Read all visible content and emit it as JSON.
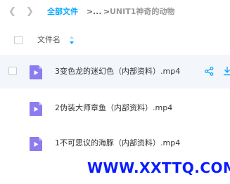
{
  "nav": {
    "back_icon": "chevron-left-icon",
    "forward_icon": "chevron-right-icon",
    "breadcrumb": {
      "root": "全部文件",
      "separator": ">",
      "ellipsis": "...",
      "current": "UNIT1神奇的动物"
    }
  },
  "list_header": {
    "name_label": "文件名",
    "sort_icon": "sort-icon"
  },
  "files": [
    {
      "name": "3变色龙的迷幻色（内部资料）.mp4",
      "icon": "video-file-icon"
    },
    {
      "name": "2伪装大师章鱼（内部资料）.mp4",
      "icon": "video-file-icon"
    },
    {
      "name": "1不可思议的海豚（内部资料）.mp4",
      "icon": "video-file-icon"
    }
  ],
  "row_actions": {
    "share_icon": "share-icon",
    "download_icon": "download-icon"
  },
  "watermark": "WWW.XXTTQ.COM",
  "colors": {
    "accent": "#06a7ff",
    "file_icon": "#8c7cf0",
    "hover_row": "#f3f6fb",
    "watermark": "#0a1cff"
  }
}
